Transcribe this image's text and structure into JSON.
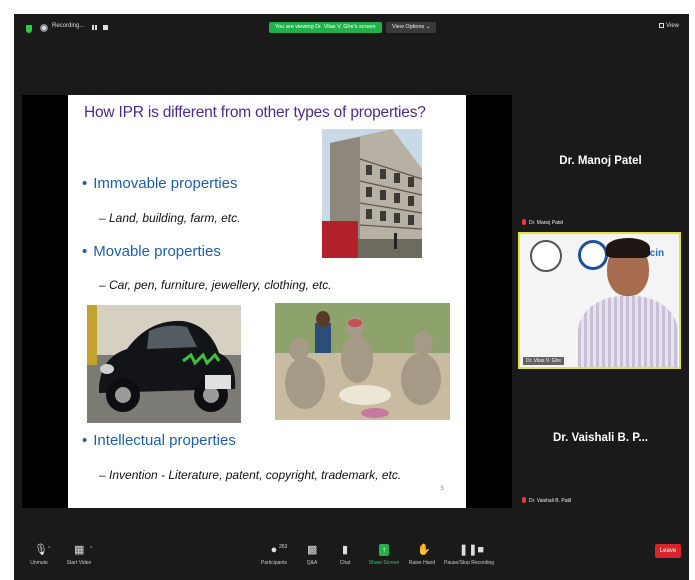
{
  "topbar": {
    "recording_label": "Recording...",
    "viewing_text": "You are viewing Dr. Vilas V. Ghe's screen",
    "view_options_label": "View Options ⌄",
    "view_label": "View"
  },
  "slide": {
    "title": "How IPR is different from other types of properties?",
    "bullet_1": "Immovable properties",
    "sub_1": "–  Land, building, farm, etc.",
    "bullet_2": "Movable properties",
    "sub_2": "– Car, pen, furniture, jewellery, clothing, etc.",
    "bullet_3": "Intellectual properties",
    "sub_3": "– Invention - Literature, patent, copyright, trademark, etc.",
    "page_number": "5",
    "bullet_glyph": "•"
  },
  "participants": {
    "tile_1_name": "Dr. Manoj Patel",
    "tile_1_small": "Dr. Manoj Patel",
    "video_label": "Dr. Vilas V. Ghe",
    "video_logo_text": "abcin",
    "tile_3_name": "Dr. Vaishali B. P...",
    "tile_3_small": "Dr. Vaishali B. Patil"
  },
  "toolbar": {
    "unmute": "Unmute",
    "start_video": "Start Video",
    "participants_count": "263",
    "participants": "Participants",
    "qa": "Q&A",
    "chat": "Chat",
    "share_screen": "Share Screen",
    "raise_hand": "Raise Hand",
    "pause_stop_recording": "Pause/Stop Recording",
    "leave": "Leave"
  },
  "colors": {
    "title_purple": "#4b2c8f",
    "bullet_blue": "#1f5fa8",
    "share_green": "#23b04b",
    "leave_red": "#d9232d",
    "active_speaker_border": "#e3e33a"
  }
}
